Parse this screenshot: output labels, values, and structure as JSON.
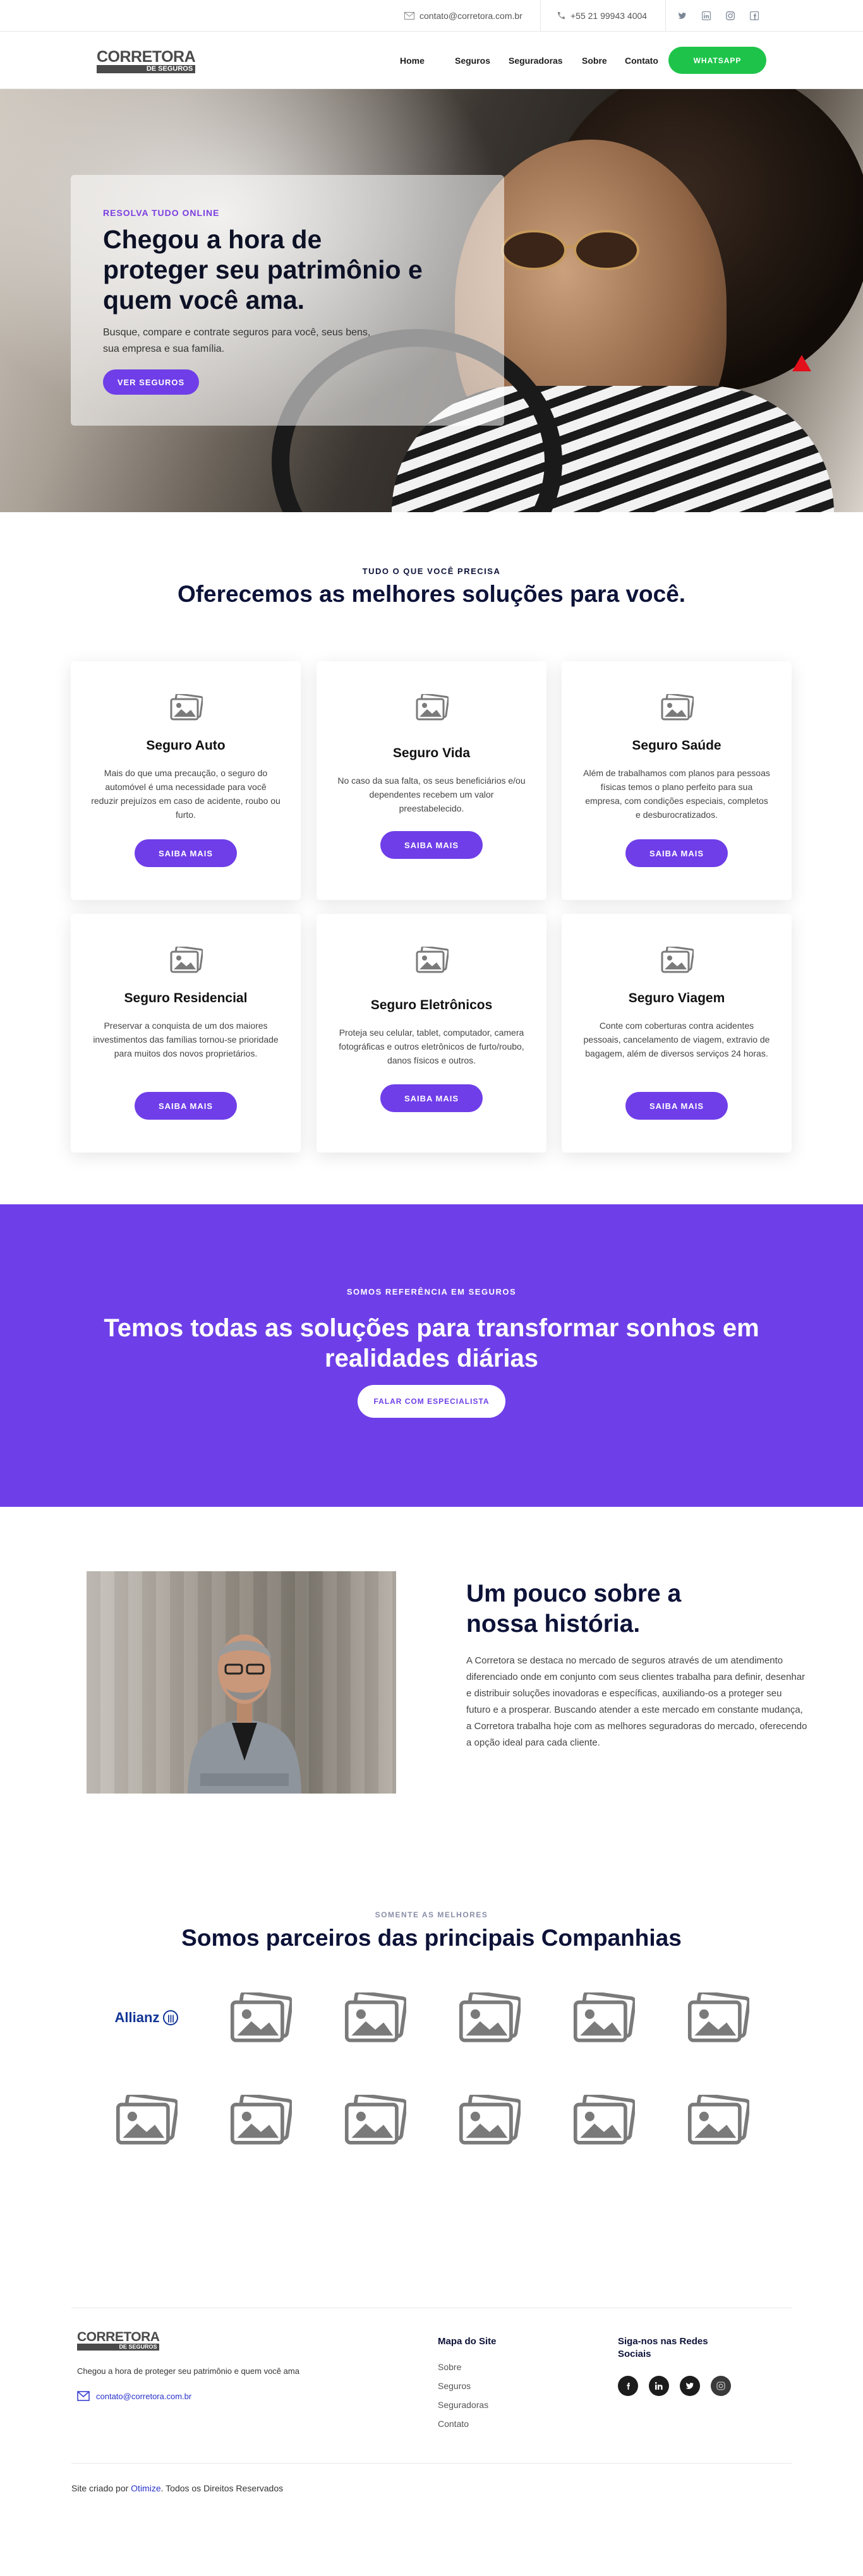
{
  "topbar": {
    "email": "contato@corretora.com.br",
    "phone": "+55 21 99943 4004",
    "social_icons": [
      "twitter-icon",
      "linkedin-icon",
      "instagram-icon",
      "facebook-icon"
    ]
  },
  "header": {
    "logo_line1": "CORRETORA",
    "logo_line2": "DE SEGUROS",
    "nav": [
      "Home",
      "Seguros",
      "Seguradoras",
      "Sobre",
      "Contato"
    ],
    "cta": "WHATSAPP"
  },
  "hero": {
    "kicker": "RESOLVA TUDO ONLINE",
    "title": "Chegou a hora de proteger seu patrimônio e quem você ama.",
    "text": "Busque, compare e contrate seguros para você, seus bens, sua empresa e sua família.",
    "button": "VER SEGUROS"
  },
  "services": {
    "kicker": "TUDO O QUE VOCÊ PRECISA",
    "title": "Oferecemos as melhores soluções para você.",
    "cards": [
      {
        "title": "Seguro Auto",
        "text": "Mais do que uma precaução, o seguro do automóvel é uma necessidade para você reduzir prejuízos em caso de acidente, roubo ou furto.",
        "button": "SAIBA MAIS"
      },
      {
        "title": "Seguro Vida",
        "text": "No caso da sua falta, os seus beneficiários e/ou dependentes recebem um valor preestabelecido.",
        "button": "SAIBA MAIS"
      },
      {
        "title": "Seguro Saúde",
        "text": "Além de trabalhamos com planos para pessoas físicas temos o plano perfeito para sua empresa, com condições especiais, completos e desburocratizados.",
        "button": "SAIBA MAIS"
      },
      {
        "title": "Seguro Residencial",
        "text": "Preservar a conquista de um dos maiores investimentos das famílias tornou-se prioridade para muitos dos novos proprietários.",
        "button": "SAIBA MAIS"
      },
      {
        "title": "Seguro Eletrônicos",
        "text": "Proteja seu celular, tablet, computador, camera fotográficas e outros eletrônicos de furto/roubo, danos físicos e outros.",
        "button": "SAIBA MAIS"
      },
      {
        "title": "Seguro Viagem",
        "text": "Conte com coberturas contra acidentes pessoais, cancelamento de viagem, extravio de bagagem, além de diversos serviços 24 horas.",
        "button": "SAIBA MAIS"
      }
    ]
  },
  "banner": {
    "kicker": "SOMOS REFERÊNCIA EM SEGUROS",
    "title": "Temos todas as soluções para transformar sonhos em realidades diárias",
    "button": "FALAR COM ESPECIALISTA"
  },
  "about": {
    "title": "Um pouco sobre a nossa história.",
    "text": "A Corretora se destaca no mercado de seguros através de um atendimento diferenciado onde em conjunto com seus clientes trabalha para definir, desenhar e distribuir soluções inovadoras e específicas, auxiliando-os a proteger seu futuro e a prosperar. Buscando atender a este mercado em constante mudança, a Corretora trabalha hoje com as melhores seguradoras do mercado, oferecendo a opção ideal para cada cliente."
  },
  "partners": {
    "kicker": "SOMENTE AS MELHORES",
    "title": "Somos parceiros das principais Companhias",
    "first_logo": "Allianz"
  },
  "footer": {
    "logo_line1": "CORRETORA",
    "logo_line2": "DE SEGUROS",
    "tagline": "Chegou a hora de proteger seu patrimônio e quem você ama",
    "email": "contato@corretora.com.br",
    "sitemap_title": "Mapa do Site",
    "sitemap": [
      "Sobre",
      "Seguros",
      "Seguradoras",
      "Contato"
    ],
    "social_title": "Siga-nos nas Redes Sociais",
    "credit_prefix": "Site criado por",
    "credit_link": "Otimize",
    "credit_suffix": ". Todos os Direitos Reservados"
  },
  "colors": {
    "accent": "#6e3fe8",
    "whatsapp": "#1ec44a",
    "heading": "#0d1238"
  }
}
